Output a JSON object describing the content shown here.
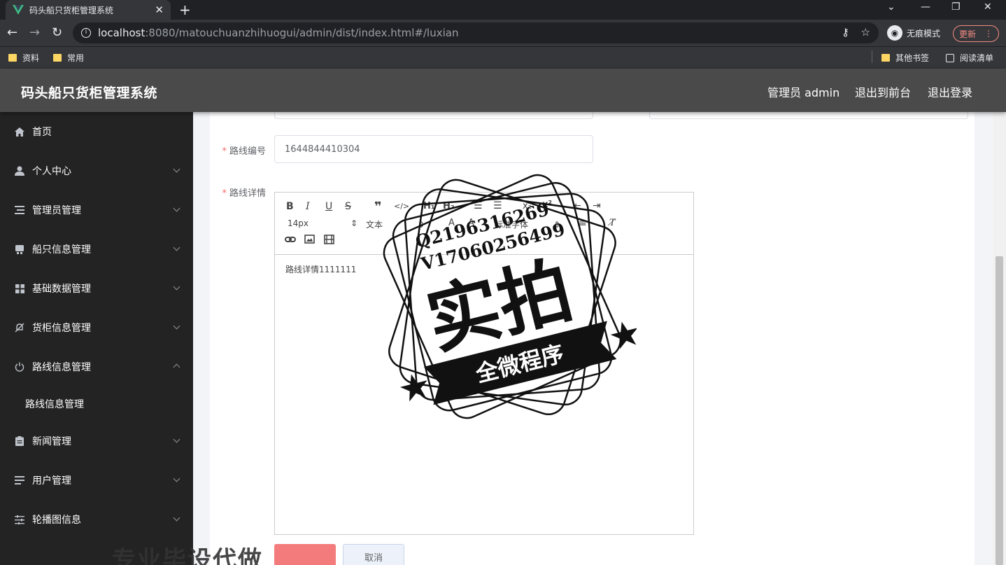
{
  "browser": {
    "tab_title": "码头船只货柜管理系统",
    "new_tab": "+",
    "url_host": "localhost",
    "url_rest": ":8080/matouchuanzhihuogui/admin/dist/index.html#/luxian",
    "incognito_label": "无痕模式",
    "update_label": "更新",
    "bookmarks": [
      "资料",
      "常用"
    ],
    "other_bookmarks": "其他书签",
    "reading_list": "阅读清单"
  },
  "header": {
    "title": "码头船只货柜管理系统",
    "user": "管理员 admin",
    "to_front": "退出到前台",
    "logout": "退出登录"
  },
  "sidebar": {
    "items": [
      {
        "label": "首页",
        "icon": "home-icon"
      },
      {
        "label": "个人中心",
        "icon": "user-icon"
      },
      {
        "label": "管理员管理",
        "icon": "list-icon"
      },
      {
        "label": "船只信息管理",
        "icon": "ship-icon"
      },
      {
        "label": "基础数据管理",
        "icon": "grid-icon"
      },
      {
        "label": "货柜信息管理",
        "icon": "bell-off-icon"
      },
      {
        "label": "路线信息管理",
        "icon": "power-icon"
      },
      {
        "label": "新闻管理",
        "icon": "clipboard-icon"
      },
      {
        "label": "用户管理",
        "icon": "list-icon"
      },
      {
        "label": "轮播图信息",
        "icon": "sliders-icon"
      }
    ],
    "submenu": "路线信息管理"
  },
  "form": {
    "route_no_label": "路线编号",
    "route_no_value": "1644844410304",
    "route_detail_label": "路线详情",
    "editor": {
      "font_size": "14px",
      "text_type": "文本",
      "font_family": "标准字体",
      "content": "路线详情1111111"
    },
    "cancel_label": "取消"
  },
  "watermark": {
    "qq": "Q2196316269",
    "wechat": "V17060256499",
    "main": "实拍",
    "banner": "全微程序",
    "bottom": "专业毕设代做"
  }
}
